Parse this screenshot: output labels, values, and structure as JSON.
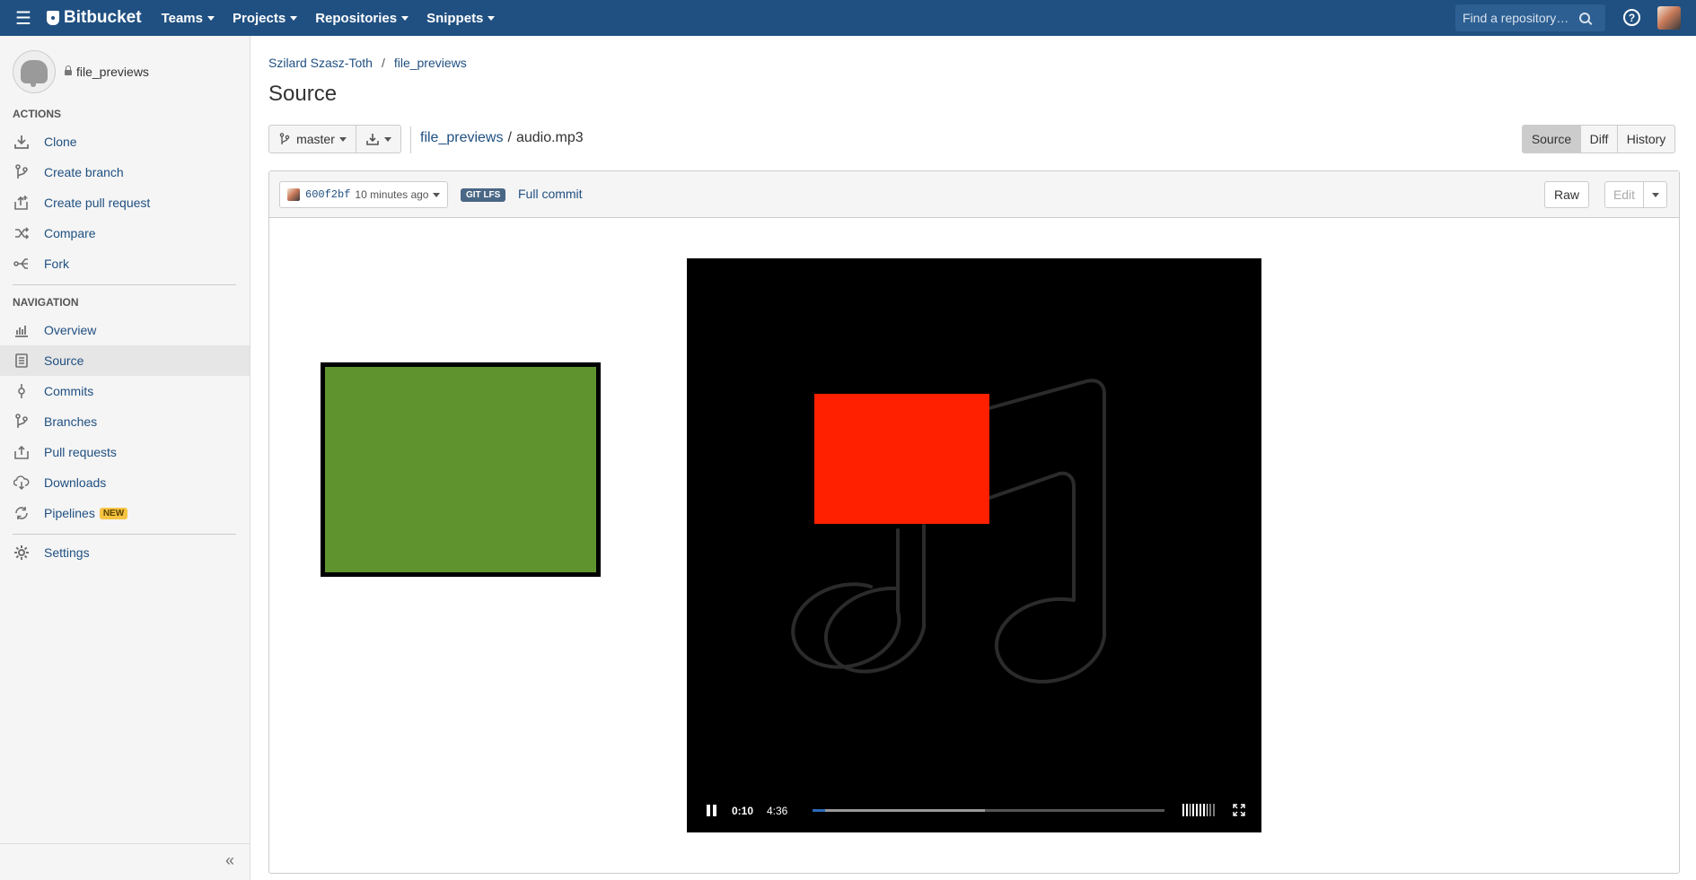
{
  "header": {
    "brand": "Bitbucket",
    "nav": [
      "Teams",
      "Projects",
      "Repositories",
      "Snippets"
    ],
    "search_placeholder": "Find a repository…",
    "help_glyph": "?"
  },
  "sidebar": {
    "repo_name": "file_previews",
    "actions_title": "ACTIONS",
    "actions": [
      {
        "label": "Clone",
        "icon": "clone-icon"
      },
      {
        "label": "Create branch",
        "icon": "branch-icon"
      },
      {
        "label": "Create pull request",
        "icon": "pull-request-icon"
      },
      {
        "label": "Compare",
        "icon": "compare-icon"
      },
      {
        "label": "Fork",
        "icon": "fork-icon"
      }
    ],
    "navigation_title": "NAVIGATION",
    "navigation": [
      {
        "label": "Overview",
        "icon": "overview-icon"
      },
      {
        "label": "Source",
        "icon": "source-icon",
        "active": true
      },
      {
        "label": "Commits",
        "icon": "commits-icon"
      },
      {
        "label": "Branches",
        "icon": "branches-icon"
      },
      {
        "label": "Pull requests",
        "icon": "pull-requests-icon"
      },
      {
        "label": "Downloads",
        "icon": "downloads-icon"
      },
      {
        "label": "Pipelines",
        "icon": "pipelines-icon",
        "badge": "NEW"
      }
    ],
    "settings": {
      "label": "Settings",
      "icon": "gear-icon"
    },
    "collapse_glyph": "«"
  },
  "main": {
    "breadcrumb": [
      "Szilard Szasz-Toth",
      "file_previews"
    ],
    "title": "Source",
    "branch": "master",
    "path_repo": "file_previews",
    "path_file": "audio.mp3",
    "view_tabs": [
      {
        "label": "Source",
        "active": true
      },
      {
        "label": "Diff",
        "active": false
      },
      {
        "label": "History",
        "active": false
      }
    ],
    "commit_hash": "600f2bf",
    "commit_time": "10 minutes ago",
    "lfs_badge": "GIT LFS",
    "full_commit": "Full commit",
    "raw_label": "Raw",
    "edit_label": "Edit"
  },
  "player": {
    "current_time": "0:10",
    "duration": "4:36",
    "played_fraction": 0.036,
    "buffered_fraction": 0.49,
    "volume_fraction": 0.8
  },
  "colors": {
    "header_bg": "#205081",
    "link": "#205081",
    "green_box": "#5e932e",
    "red_box": "#ff2000",
    "lfs_badge_bg": "#4a6785",
    "new_badge_bg": "#f6c342"
  }
}
